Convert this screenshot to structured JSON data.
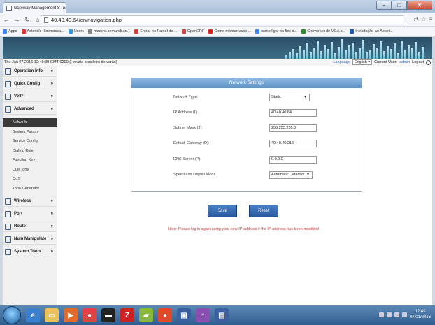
{
  "browser": {
    "tab_title": "Gateway Management Sc",
    "tab_close": "×",
    "url": "40.40.40.64/en/navigation.php",
    "bookmarks": [
      {
        "label": "Apps",
        "color": "#4285f4"
      },
      {
        "label": "Asterisk - licenciosa...",
        "color": "#d33"
      },
      {
        "label": "Users",
        "color": "#3a9ad9"
      },
      {
        "label": "modelo.semundi.co...",
        "color": "#888"
      },
      {
        "label": "Entrar no Painel de ...",
        "color": "#d7433b"
      },
      {
        "label": "OpenERP",
        "color": "#cc4444"
      },
      {
        "label": "Como montar cabo ...",
        "color": "#e02424"
      },
      {
        "label": "como ligar os fios d...",
        "color": "#4285f4"
      },
      {
        "label": "Conversor de VGA p...",
        "color": "#2e8b2e"
      },
      {
        "label": "Introdução ao Asteri...",
        "color": "#1e5aa8"
      }
    ]
  },
  "infobar": {
    "datetime": "Thu Jan 07 2016 12:49:39 GMT-0200 (Horário brasileiro de verão)",
    "language_label": "Language",
    "language_value": "English",
    "user_label": "Current User:",
    "user_value": "admin",
    "logout_label": "Logout"
  },
  "sidebar": {
    "menus": [
      {
        "label": "Operation Info",
        "chevron": "»"
      },
      {
        "label": "Quick Config",
        "chevron": "»"
      },
      {
        "label": "VoIP",
        "chevron": "»"
      },
      {
        "label": "Advanced",
        "chevron": "«"
      }
    ],
    "sub_items": [
      "Network",
      "System Param",
      "Service Config",
      "Dialing Rule",
      "Function Key",
      "Cue Tone",
      "QoS",
      "Tone Generator"
    ],
    "menus_bottom": [
      {
        "label": "Wireless",
        "chevron": "»"
      },
      {
        "label": "Port",
        "chevron": "»"
      },
      {
        "label": "Route",
        "chevron": "»"
      },
      {
        "label": "Num Manipulate",
        "chevron": "»"
      },
      {
        "label": "System Tools",
        "chevron": "»"
      }
    ]
  },
  "network_settings": {
    "title": "Network Settings",
    "rows": [
      {
        "label": "Network Type:",
        "value": "Static"
      },
      {
        "label": "IP Address (I):",
        "value": "40.40.40.64"
      },
      {
        "label": "Subnet Mask (J):",
        "value": "255.255.255.0"
      },
      {
        "label": "Default Gateway (D):",
        "value": "40.40.40.216"
      },
      {
        "label": "DNS Server (P):",
        "value": "0.0.0.0"
      },
      {
        "label": "Speed and Duplex Mode",
        "value": "Automatic Detectio"
      }
    ],
    "save_label": "Save",
    "reset_label": "Reset",
    "note": "Note: Please log in again using your new IP address if the IP address has been modified!"
  },
  "taskbar": {
    "time": "12:49",
    "date": "07/01/2016"
  }
}
